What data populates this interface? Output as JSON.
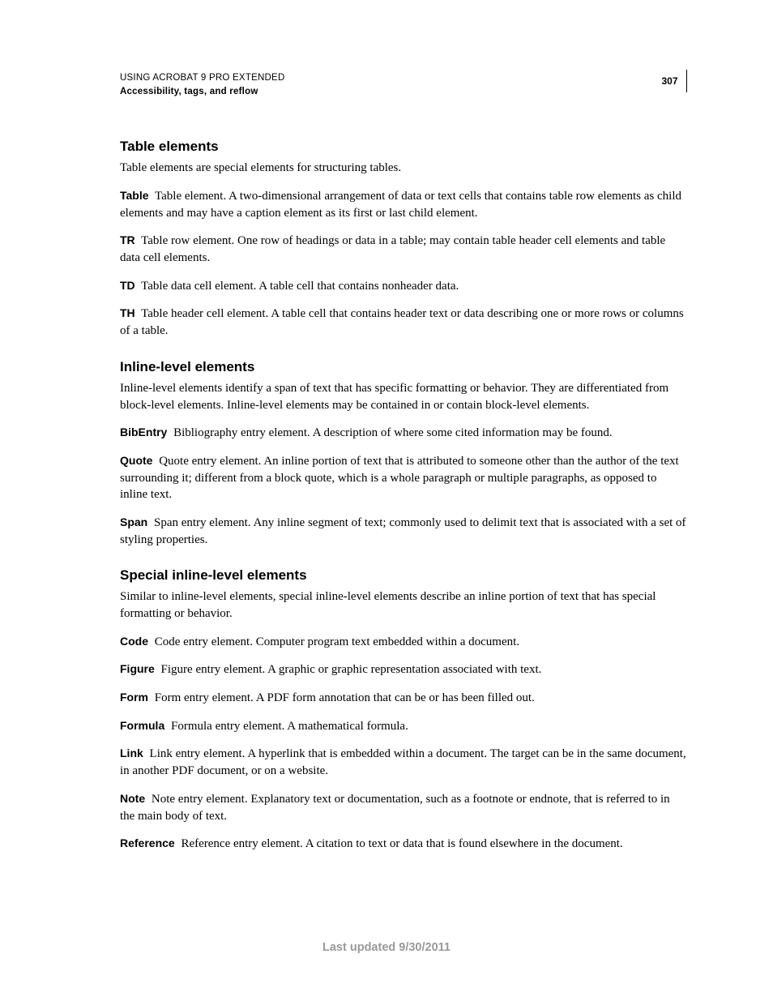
{
  "header": {
    "line1": "USING ACROBAT 9 PRO EXTENDED",
    "line2": "Accessibility, tags, and reflow",
    "page_number": "307"
  },
  "sections": [
    {
      "title": "Table elements",
      "intro": "Table elements are special elements for structuring tables.",
      "definitions": [
        {
          "term": "Table",
          "desc": "Table element. A two-dimensional arrangement of data or text cells that contains table row elements as child elements and may have a caption element as its first or last child element."
        },
        {
          "term": "TR",
          "desc": "Table row element. One row of headings or data in a table; may contain table header cell elements and table data cell elements."
        },
        {
          "term": "TD",
          "desc": "Table data cell element. A table cell that contains nonheader data."
        },
        {
          "term": "TH",
          "desc": "Table header cell element. A table cell that contains header text or data describing one or more rows or columns of a table."
        }
      ]
    },
    {
      "title": "Inline-level elements",
      "intro": "Inline-level elements identify a span of text that has specific formatting or behavior. They are differentiated from block-level elements. Inline-level elements may be contained in or contain block-level elements.",
      "definitions": [
        {
          "term": "BibEntry",
          "desc": "Bibliography entry element. A description of where some cited information may be found."
        },
        {
          "term": "Quote",
          "desc": "Quote entry element. An inline portion of text that is attributed to someone other than the author of the text surrounding it; different from a block quote, which is a whole paragraph or multiple paragraphs, as opposed to inline text."
        },
        {
          "term": "Span",
          "desc": "Span entry element. Any inline segment of text; commonly used to delimit text that is associated with a set of styling properties."
        }
      ]
    },
    {
      "title": "Special inline-level elements",
      "intro": "Similar to inline-level elements, special inline-level elements describe an inline portion of text that has special formatting or behavior.",
      "definitions": [
        {
          "term": "Code",
          "desc": "Code entry element. Computer program text embedded within a document."
        },
        {
          "term": "Figure",
          "desc": "Figure entry element. A graphic or graphic representation associated with text."
        },
        {
          "term": "Form",
          "desc": "Form entry element. A PDF form annotation that can be or has been filled out."
        },
        {
          "term": "Formula",
          "desc": "Formula entry element. A mathematical formula."
        },
        {
          "term": "Link",
          "desc": "Link entry element. A hyperlink that is embedded within a document. The target can be in the same document, in another PDF document, or on a website."
        },
        {
          "term": "Note",
          "desc": "Note entry element. Explanatory text or documentation, such as a footnote or endnote, that is referred to in the main body of text."
        },
        {
          "term": "Reference",
          "desc": "Reference entry element. A citation to text or data that is found elsewhere in the document."
        }
      ]
    }
  ],
  "footer": "Last updated 9/30/2011"
}
